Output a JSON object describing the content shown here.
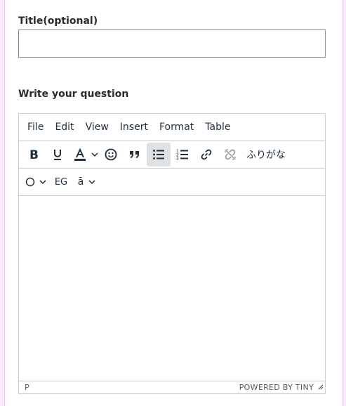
{
  "form": {
    "title_label": "Title(optional)",
    "title_value": "",
    "title_placeholder": "",
    "question_label": "Write your question"
  },
  "editor": {
    "menu": [
      "File",
      "Edit",
      "View",
      "Insert",
      "Format",
      "Table"
    ],
    "toolbar_row1": {
      "icons": [
        "bold-icon",
        "underline-icon",
        "text-color-icon",
        "emoji-icon",
        "blockquote-icon",
        "bullet-list-icon",
        "numbered-list-icon",
        "link-icon",
        "unlink-icon"
      ],
      "active": "bullet-list-icon",
      "furigana_label": "ふりがな"
    },
    "toolbar_row2": {
      "icons": [
        "circle-icon"
      ],
      "eg_label": "EG",
      "macron_label": "ā"
    },
    "statusbar": {
      "path": "P",
      "branding": "POWERED BY TINY"
    },
    "colors": {
      "border": "#cccccc",
      "active_bg": "#dee0e2",
      "text_color_underline": "#222f3e"
    }
  },
  "page": {
    "edge_color": "#fbeafc"
  }
}
